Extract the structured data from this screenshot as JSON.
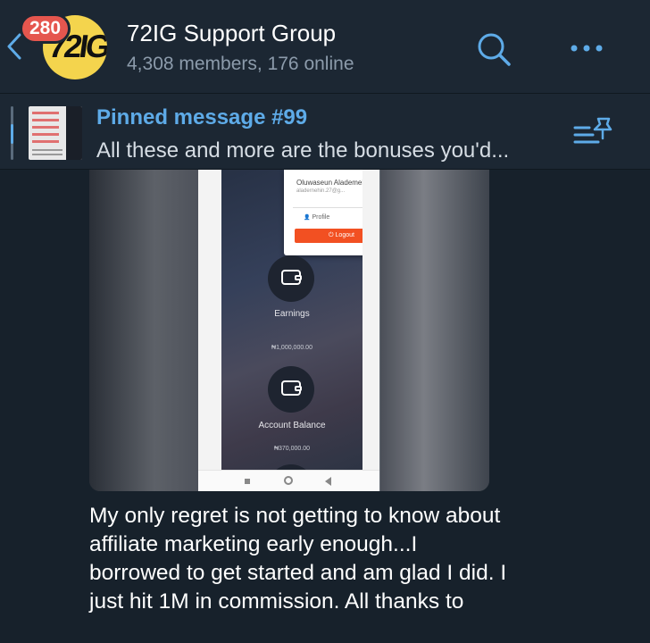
{
  "header": {
    "unread_count": "280",
    "avatar_text": "72IG",
    "title": "72IG Support Group",
    "subtitle": "4,308 members, 176 online"
  },
  "pinned": {
    "title": "Pinned message #99",
    "text": "All these and more are the bonuses you'd..."
  },
  "screenshot": {
    "user_name": "Oluwaseun Alademehin",
    "user_email": "aladernehin.27@g...",
    "profile_label": "Profile",
    "logout_label": "Logout",
    "logout_glyph": "⏻",
    "profile_glyph": "👤",
    "earnings_label": "Earnings",
    "earnings_value": "₦1,000,000.00",
    "balance_label": "Account Balance",
    "balance_value": "₦370,000.00"
  },
  "message": {
    "text": "My only regret is not getting to know about affiliate marketing early enough...I borrowed to get started and am glad I did. I just hit 1M in commission. All thanks to"
  },
  "colors": {
    "background": "#17212b",
    "header": "#1c2733",
    "accent": "#5eabe8",
    "badge": "#e5564e",
    "avatar": "#f4d44d",
    "logout": "#f25022"
  },
  "icons": [
    "back-arrow-icon",
    "search-icon",
    "more-icon",
    "pin-list-icon",
    "wallet-icon",
    "user-icon",
    "power-icon"
  ]
}
